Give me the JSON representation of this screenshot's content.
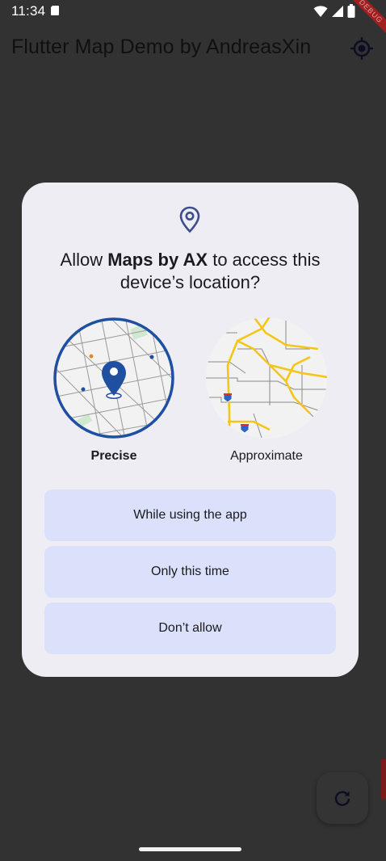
{
  "status_bar": {
    "time": "11:34"
  },
  "debug_banner": "DEBUG",
  "app_bar": {
    "title": "Flutter Map Demo by AndreasXin"
  },
  "dialog": {
    "title_prefix": "Allow ",
    "app_name": "Maps by AX",
    "title_suffix": " to access this device’s location?",
    "options": [
      {
        "label": "Precise",
        "selected": true
      },
      {
        "label": "Approximate",
        "selected": false
      }
    ],
    "buttons": {
      "while_using": "While using the app",
      "only_this_time": "Only this time",
      "dont_allow": "Don’t allow"
    }
  },
  "colors": {
    "accent_blue": "#1f4fa0",
    "button_bg": "#dbe1fb",
    "dialog_bg": "#eeedf4",
    "road_yellow": "#f5c518"
  },
  "icons": [
    "sd-card-icon",
    "wifi-icon",
    "signal-icon",
    "battery-icon",
    "my-location-icon",
    "location-pin-icon",
    "refresh-icon"
  ]
}
